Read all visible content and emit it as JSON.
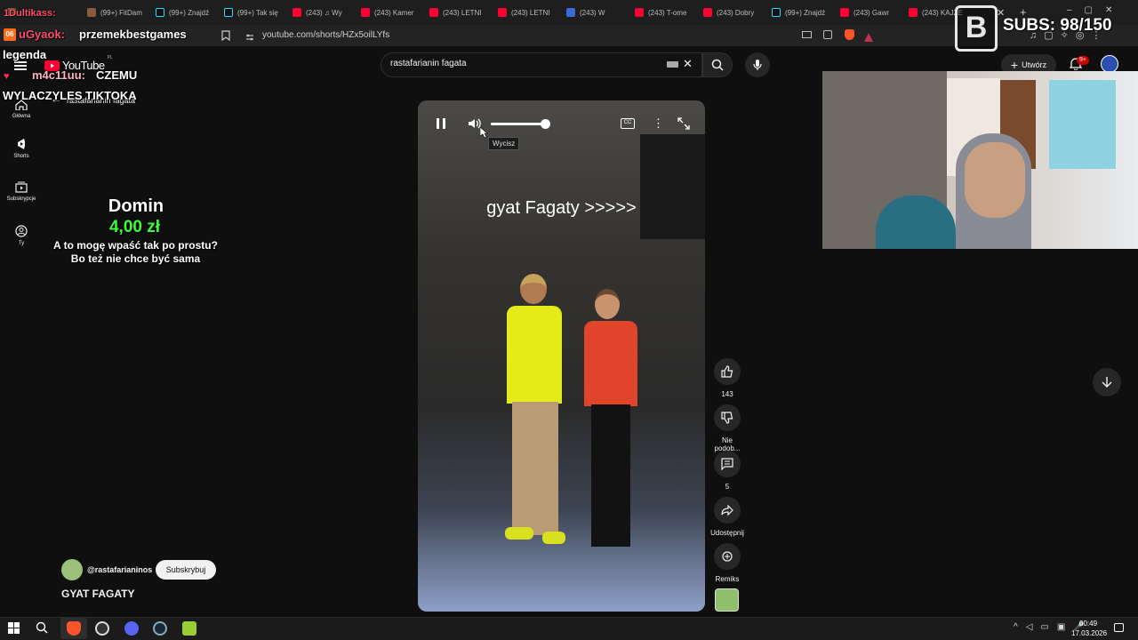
{
  "browser": {
    "tabs": [
      {
        "label": "",
        "kind": "pic"
      },
      {
        "label": "(99+) FitDam",
        "kind": "pic"
      },
      {
        "label": "(99+) Znajdź",
        "kind": "tt"
      },
      {
        "label": "(99+) Tak się",
        "kind": "tt"
      },
      {
        "label": "(243) ♫ Wy",
        "kind": "yt"
      },
      {
        "label": "(243) Kamer",
        "kind": "yt"
      },
      {
        "label": "(243) LETNI",
        "kind": "yt"
      },
      {
        "label": "(243) LETNI",
        "kind": "yt"
      },
      {
        "label": "(243) W",
        "kind": "ch"
      },
      {
        "label": "(243) T-ome",
        "kind": "yt"
      },
      {
        "label": "(243) Dobry",
        "kind": "yt"
      },
      {
        "label": "(99+) Znajdź",
        "kind": "tt"
      },
      {
        "label": "(243) Gawr",
        "kind": "yt"
      },
      {
        "label": "(243) KAJZE",
        "kind": "yt"
      }
    ],
    "url": "youtube.com/shorts/HZx5oilLYfs"
  },
  "youtube": {
    "logo_text": "YouTube",
    "logo_region": "PL",
    "search_query": "rastafarianin fagata",
    "create_label": "Utwórz",
    "notif_count": "9+",
    "back_label": "rastafarianin fagata",
    "sidebar": [
      {
        "label": "Główna",
        "icon": "home-icon"
      },
      {
        "label": "Shorts",
        "icon": "shorts-icon"
      },
      {
        "label": "Subskrypcje",
        "icon": "subscriptions-icon"
      },
      {
        "label": "Ty",
        "icon": "you-icon"
      }
    ],
    "video": {
      "caption": "gyat Fagaty >>>>>",
      "tooltip": "Wycisz",
      "volume_level": 0.92
    },
    "actions": {
      "likes": "143",
      "dislike": "Nie podob...",
      "comments": "5",
      "share": "Udostępnij",
      "remix": "Remiks"
    },
    "channel": "@rastafarianinos",
    "subscribe_label": "Subskrybuj",
    "short_title": "GYAT FAGATY"
  },
  "overlay": {
    "chat_name1": "1Dultikass:",
    "chat_rank": "06",
    "chat_name2": "uGyaok:",
    "chat_msg1": "przemekbestgames",
    "chat_line2": "legenda",
    "chat_name3": "m4c11uu:",
    "chat_msg3a": "CZEMU",
    "chat_msg3b": "WYLACZYLES TIKTOKA",
    "donation_name": "Domin",
    "donation_amount": "4,00 zł",
    "donation_msg1": "A to mogę wpaść tak po prostu?",
    "donation_msg2": "Bo też nie chce być sama",
    "subs_goal": "SUBS: 98/150",
    "logo_letter": "B"
  },
  "taskbar": {
    "time": "00:49",
    "date": "17.03.2026"
  },
  "colors": {
    "donation_amount": "#3bff3b",
    "yt_red": "#ff0033",
    "video_floor": "#8ea0c8"
  }
}
